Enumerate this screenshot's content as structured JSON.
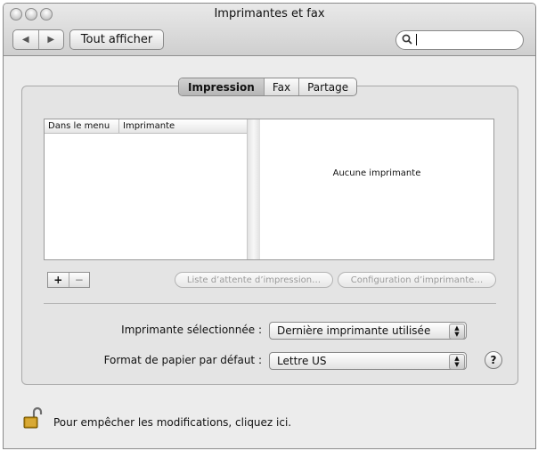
{
  "window": {
    "title": "Imprimantes et fax"
  },
  "toolbar": {
    "back_icon": "triangle-left",
    "forward_icon": "triangle-right",
    "show_all_label": "Tout afficher",
    "search_icon": "magnifier",
    "search_value": ""
  },
  "tabs": [
    {
      "label": "Impression",
      "active": true
    },
    {
      "label": "Fax",
      "active": false
    },
    {
      "label": "Partage",
      "active": false
    }
  ],
  "printer_list": {
    "columns": [
      "Dans le menu",
      "Imprimante"
    ],
    "rows": []
  },
  "info_panel": {
    "text": "Aucune imprimante"
  },
  "list_buttons": {
    "add": "+",
    "remove": "−"
  },
  "actions": {
    "queue_label": "Liste d’attente d’impression…",
    "config_label": "Configuration d’imprimante…"
  },
  "settings": {
    "selected_printer_label": "Imprimante sélectionnée :",
    "selected_printer_value": "Dernière imprimante utilisée",
    "paper_format_label": "Format de papier par défaut :",
    "paper_format_value": "Lettre US"
  },
  "help_label": "?",
  "footer": {
    "lock_text": "Pour empêcher les modifications, cliquez ici."
  },
  "colors": {
    "window_bg": "#ececec",
    "panel_bg": "#e4e4e4"
  }
}
